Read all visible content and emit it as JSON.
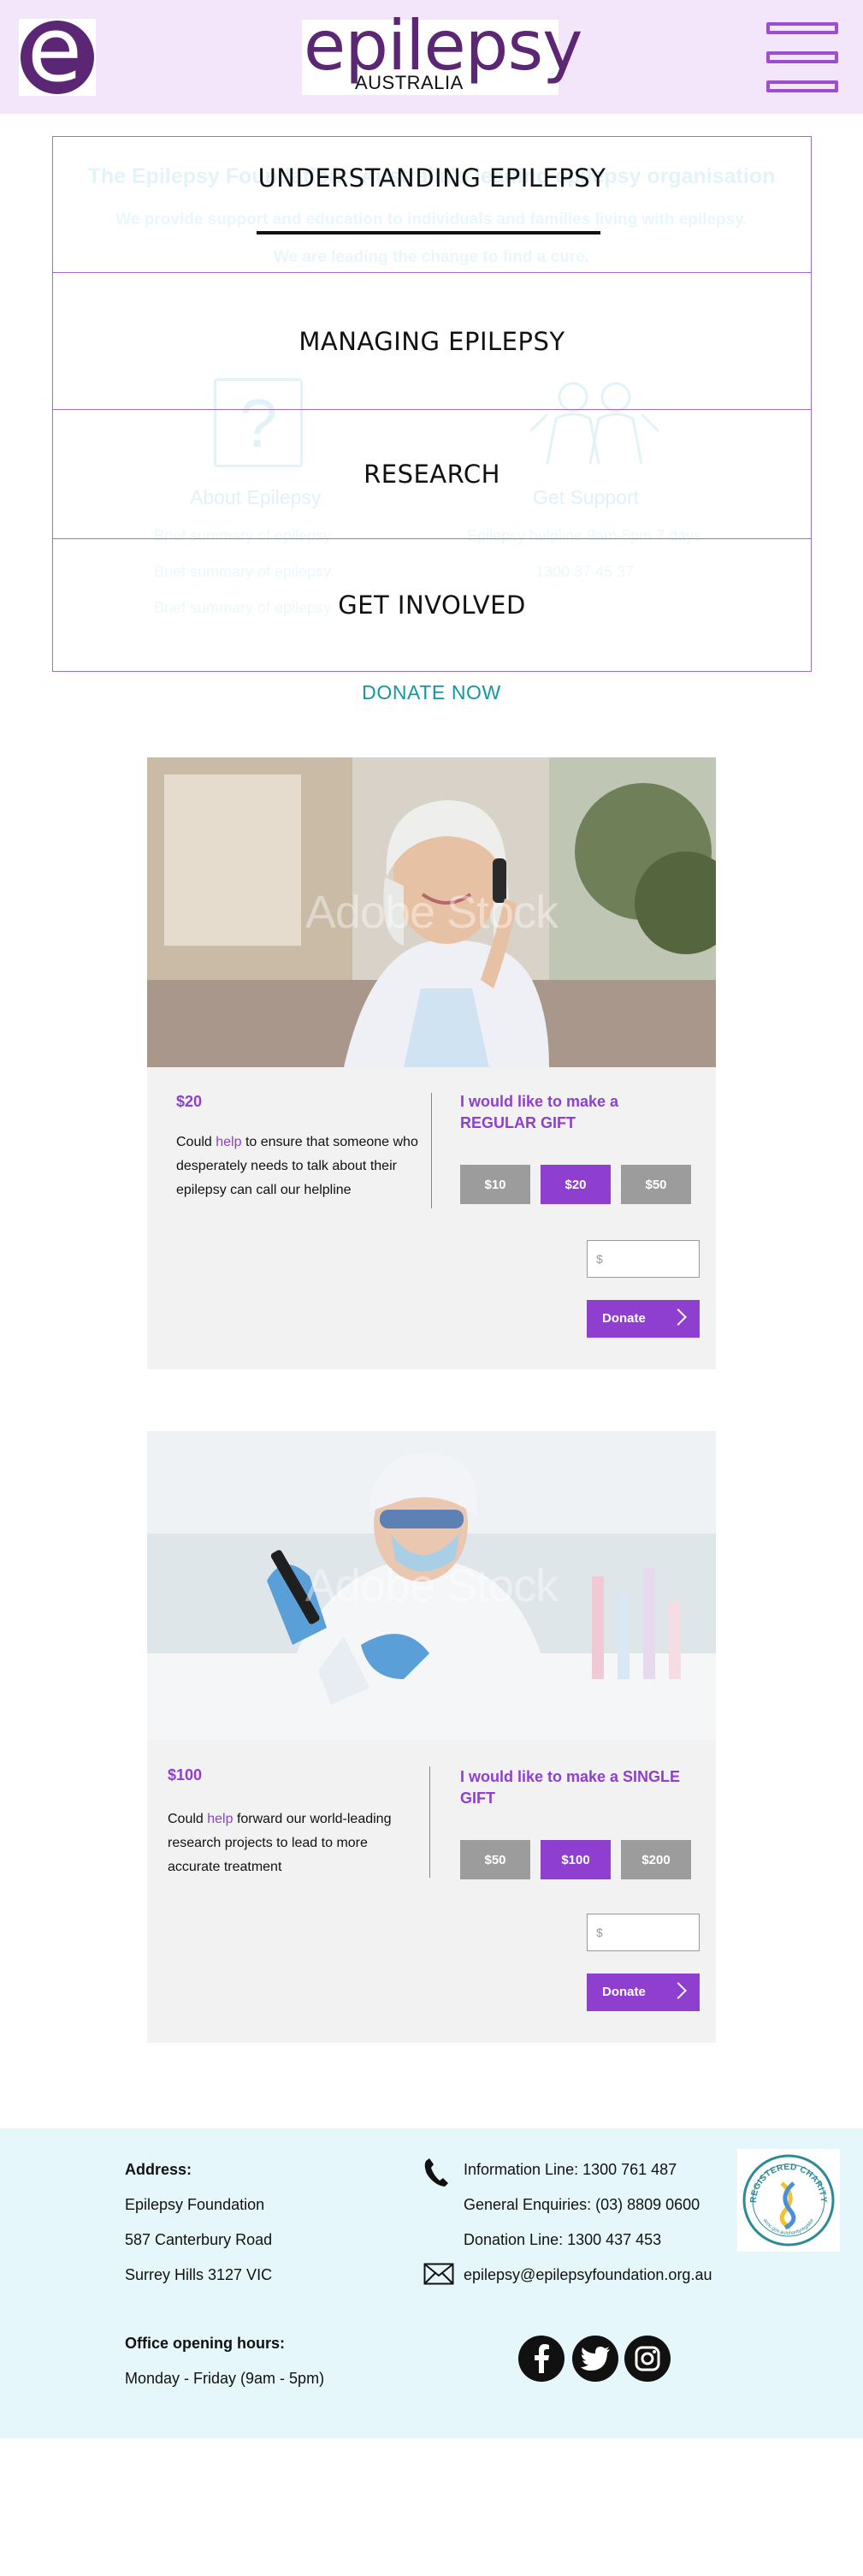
{
  "header": {
    "logo_letter": "e",
    "logo_word": "epilepsy",
    "logo_sub": "AUSTRALIA"
  },
  "hero": {
    "title": "The Epilepsy Foundation - Australia's leading epilepsy organisation",
    "line1": "We provide support and education to individuals and families living with epilepsy.",
    "line2": "We are leading the change to find a cure.",
    "about": {
      "title": "About Epilepsy",
      "items": [
        "Brief summary of epilepsy",
        "Brief summary of epilepsy",
        "Brief summary of epilepsy"
      ]
    },
    "support": {
      "title": "Get Support",
      "items": [
        "Epilepsy helpline 9am-5pm 7 days",
        "1300 37 45 37"
      ]
    }
  },
  "menu": {
    "items": [
      {
        "label": "UNDERSTANDING EPILEPSY",
        "active": true
      },
      {
        "label": "MANAGING EPILEPSY",
        "active": false
      },
      {
        "label": "RESEARCH",
        "active": false
      },
      {
        "label": "GET INVOLVED",
        "active": false
      }
    ]
  },
  "donate_now": "DONATE NOW",
  "cards": [
    {
      "watermark": "Adobe Stock",
      "price": "$20",
      "desc_pre": "Could ",
      "desc_hl": "help",
      "desc_post": " to ensure that someone who desperately needs to talk about their epilepsy can call our helpline",
      "gift_title": "I would like to make a REGULAR GIFT",
      "amounts": [
        "$10",
        "$20",
        "$50"
      ],
      "selected_index": 1,
      "input_placeholder": "$",
      "donate_label": "Donate"
    },
    {
      "watermark": "Adobe Stock",
      "price": "$100",
      "desc_pre": "Could ",
      "desc_hl": "help",
      "desc_post": " forward our world-leading research projects to lead to more accurate treatment",
      "gift_title": "I would like to make a SINGLE GIFT",
      "amounts": [
        "$50",
        "$100",
        "$200"
      ],
      "selected_index": 1,
      "input_placeholder": "$",
      "donate_label": "Donate"
    }
  ],
  "footer": {
    "address_label": "Address:",
    "address_lines": [
      "Epilepsy Foundation",
      "587 Canterbury Road",
      "Surrey Hills 3127 VIC"
    ],
    "contacts": [
      "Information Line: 1300 761 487",
      "General Enquiries: (03) 8809 0600",
      "Donation Line: 1300 437 453",
      "epilepsy@epilepsyfoundation.org.au"
    ],
    "hours_label": "Office opening hours:",
    "hours": "Monday - Friday (9am - 5pm)",
    "charity_text": "REGISTERED CHARITY",
    "charity_sub": "acnc.gov.au/charityregister",
    "social_icons": [
      "facebook-icon",
      "twitter-icon",
      "instagram-icon"
    ]
  },
  "colors": {
    "header_bg": "#f3e6fb",
    "brand_purple": "#5b2674",
    "accent_purple": "#8e3fcf",
    "donate_teal": "#1596a0",
    "footer_bg": "#e6f7fb"
  }
}
